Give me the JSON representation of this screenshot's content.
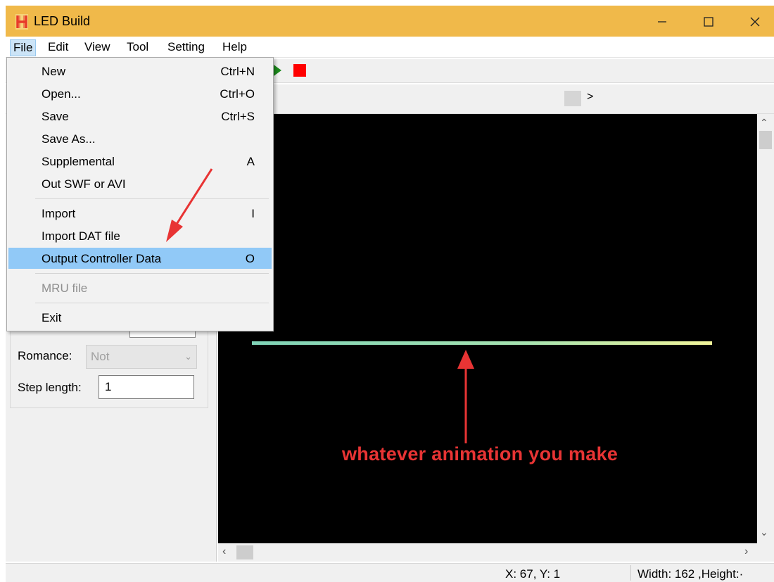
{
  "app": {
    "title": "LED Build",
    "logo_letter": "H"
  },
  "menubar": {
    "items": [
      {
        "label": "File"
      },
      {
        "label": "Edit"
      },
      {
        "label": "View"
      },
      {
        "label": "Tool"
      },
      {
        "label": "Setting"
      },
      {
        "label": "Help"
      }
    ]
  },
  "file_menu": {
    "items": [
      {
        "label": "New",
        "shortcut": "Ctrl+N"
      },
      {
        "label": "Open...",
        "shortcut": "Ctrl+O"
      },
      {
        "label": "Save",
        "shortcut": "Ctrl+S"
      },
      {
        "label": "Save As...",
        "shortcut": ""
      },
      {
        "label": "Supplemental",
        "shortcut": "A"
      },
      {
        "label": "Out SWF or AVI",
        "shortcut": ""
      },
      {
        "label": "Import",
        "shortcut": "I"
      },
      {
        "label": "Import DAT file",
        "shortcut": ""
      },
      {
        "label": "Output Controller Data",
        "shortcut": "O",
        "selected": true
      },
      {
        "label": "MRU file",
        "shortcut": "",
        "disabled": true
      },
      {
        "label": "Exit",
        "shortcut": ""
      }
    ]
  },
  "left_panel": {
    "romance_label": "Romance:",
    "romance_value": "Not",
    "step_label": "Step length:",
    "step_value": "1"
  },
  "frame_strip": {
    "right_arrow": ">"
  },
  "canvas": {
    "annotation": "whatever animation you make"
  },
  "statusbar": {
    "coords": "X: 67, Y: 1",
    "size": "Width: 162 ,Height:·"
  },
  "colors": {
    "titlebar": "#f0b94a",
    "menu_selected": "#91c9f7",
    "annotation_red": "#e83434",
    "canvas_bg": "#000000",
    "stop_red": "#ff0000",
    "play_green": "#1d8a1d"
  },
  "icons": [
    "app-logo-icon",
    "minimize-icon",
    "maximize-icon",
    "close-icon",
    "play-icon",
    "stop-icon",
    "chevron-down-icon",
    "scroll-up-icon",
    "scroll-down-icon",
    "scroll-left-icon",
    "scroll-right-icon"
  ]
}
